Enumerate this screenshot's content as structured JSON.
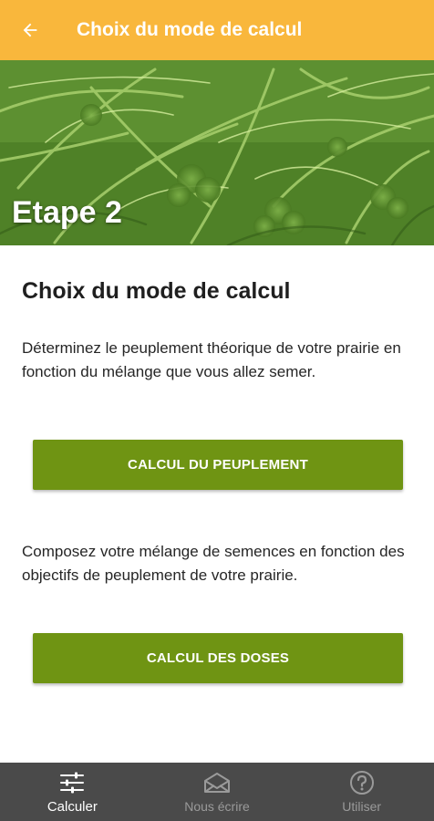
{
  "appbar": {
    "title": "Choix du mode de calcul",
    "back_icon": "arrow-left-icon",
    "background_color": "#f9b73c"
  },
  "hero": {
    "step_label": "Etape 2",
    "image": "grass-and-clover-photo"
  },
  "main": {
    "title": "Choix du mode de calcul",
    "description_peuplement": "Déterminez le peuplement théorique de votre prairie en fonction du mélange que vous allez semer.",
    "button_peuplement": "CALCUL DU PEUPLEMENT",
    "description_doses": "Composez votre mélange de semences en fonction des objectifs de peuplement de votre prairie.",
    "button_doses": "CALCUL DES DOSES",
    "button_color": "#6f9413"
  },
  "bottom_nav": {
    "items": [
      {
        "label": "Calculer",
        "icon": "sliders-icon",
        "active": true
      },
      {
        "label": "Nous écrire",
        "icon": "envelope-icon",
        "active": false
      },
      {
        "label": "Utiliser",
        "icon": "help-circle-icon",
        "active": false
      }
    ],
    "background_color": "#4a4a4a"
  }
}
